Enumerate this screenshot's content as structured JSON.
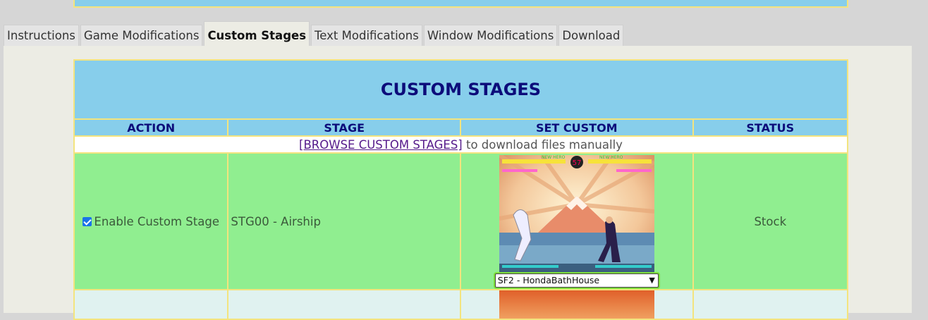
{
  "tabs": [
    {
      "label": "Instructions",
      "active": false
    },
    {
      "label": "Game Modifications",
      "active": false
    },
    {
      "label": "Custom Stages",
      "active": true
    },
    {
      "label": "Text Modifications",
      "active": false
    },
    {
      "label": "Window Modifications",
      "active": false
    },
    {
      "label": "Download",
      "active": false
    }
  ],
  "table": {
    "title": "CUSTOM STAGES",
    "headers": {
      "action": "ACTION",
      "stage": "STAGE",
      "set_custom": "SET CUSTOM",
      "status": "STATUS"
    },
    "browse": {
      "link": "[BROWSE CUSTOM STAGES]",
      "text": " to download files manually"
    },
    "rows": [
      {
        "enable_label": "Enable Custom Stage",
        "enabled": true,
        "stage": "STG00 - Airship",
        "custom_select": "SF2 - HondaBathHouse",
        "status": "Stock",
        "hud": {
          "p1": "NEW HERO",
          "p2": "NEW HERO",
          "timer": "57"
        }
      }
    ]
  },
  "colors": {
    "header_bg": "#87ceeb",
    "header_text": "#0c0c7a",
    "row_green": "#90ee90",
    "border_yellow": "#f3e47e",
    "select_highlight": "#7ee03c"
  }
}
